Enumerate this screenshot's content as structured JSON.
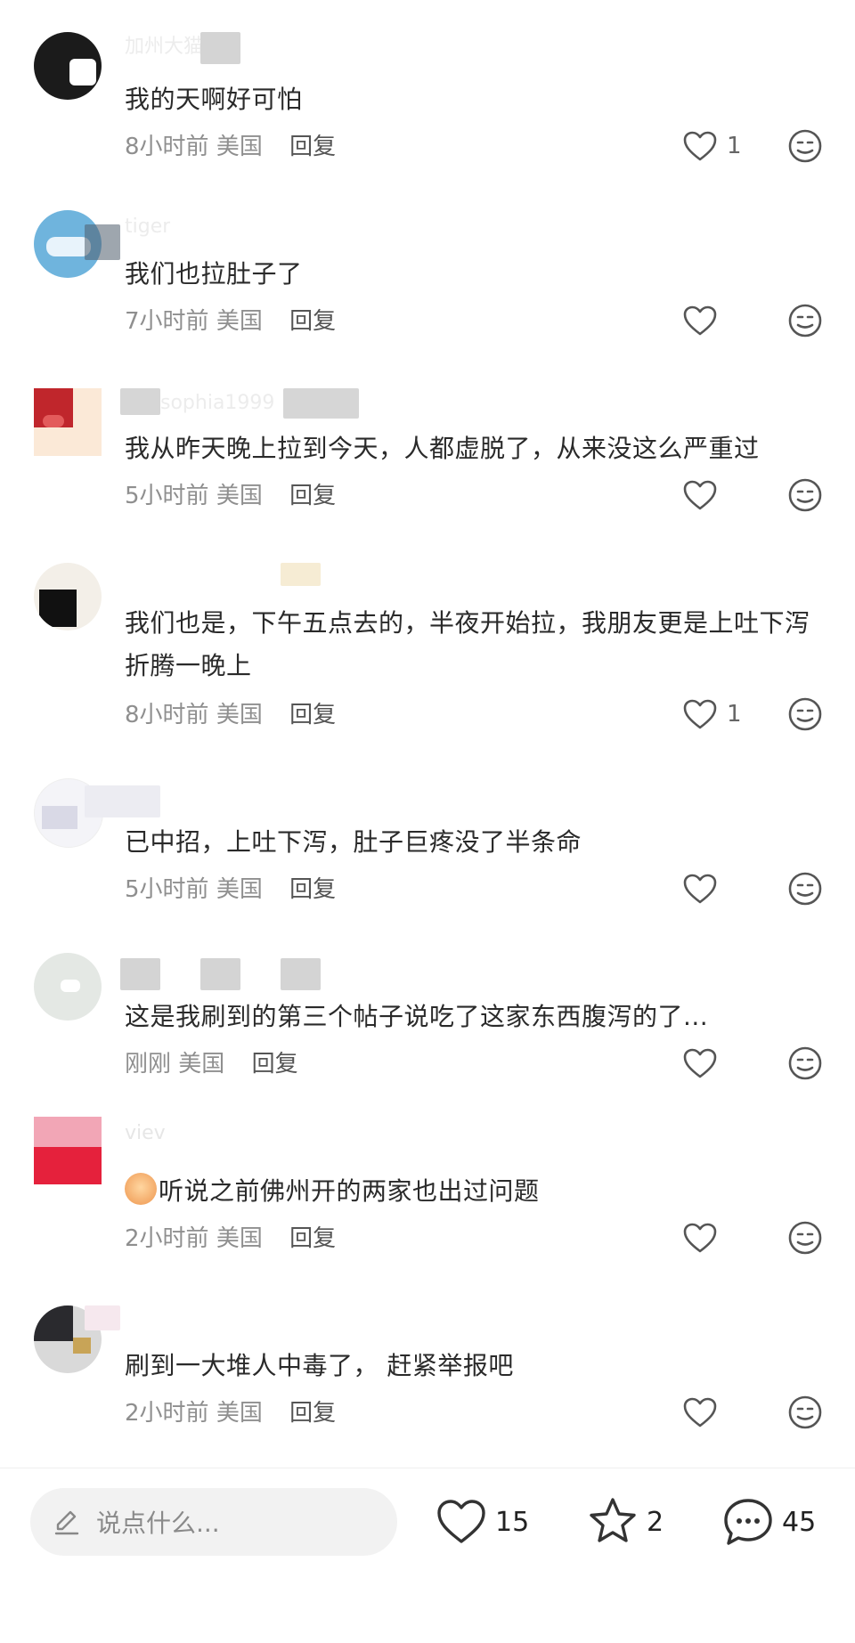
{
  "comments": [
    {
      "username": "加州大猫猫",
      "text": "我的天啊好可怕",
      "time": "8小时前",
      "location": "美国",
      "reply_label": "回复",
      "likes": "1"
    },
    {
      "username": "tiger",
      "text": "我们也拉肚子了",
      "time": "7小时前",
      "location": "美国",
      "reply_label": "回复",
      "likes": ""
    },
    {
      "username": "sophia1999",
      "text": "我从昨天晚上拉到今天，人都虚脱了，从来没这么严重过",
      "time": "5小时前",
      "location": "美国",
      "reply_label": "回复",
      "likes": ""
    },
    {
      "username": "",
      "text": "我们也是，下午五点去的，半夜开始拉，我朋友更是上吐下泻折腾一晚上",
      "time": "8小时前",
      "location": "美国",
      "reply_label": "回复",
      "likes": "1"
    },
    {
      "username": "",
      "text": "已中招，上吐下泻，肚子巨疼没了半条命",
      "time": "5小时前",
      "location": "美国",
      "reply_label": "回复",
      "likes": ""
    },
    {
      "username": "",
      "text": "这是我刷到的第三个帖子说吃了这家东西腹泻的了...",
      "time": "刚刚",
      "location": "美国",
      "reply_label": "回复",
      "likes": ""
    },
    {
      "username": "viev",
      "text": "听说之前佛州开的两家也出过问题",
      "time": "2小时前",
      "location": "美国",
      "reply_label": "回复",
      "likes": ""
    },
    {
      "username": "",
      "text": "刷到一大堆人中毒了， 赶紧举报吧",
      "time": "2小时前",
      "location": "美国",
      "reply_label": "回复",
      "likes": ""
    }
  ],
  "bottom_bar": {
    "input_placeholder": "说点什么...",
    "like_count": "15",
    "star_count": "2",
    "comment_count": "45"
  },
  "icons": {
    "like": "heart-outline-icon",
    "emoji": "meh-face-icon",
    "pen": "pen-icon",
    "star": "star-outline-icon",
    "comment": "chat-bubble-icon"
  },
  "colors": {
    "icon_stroke": "#555555",
    "text_primary": "#2a2a2a",
    "text_meta": "#8f8f8f",
    "input_bg": "#f2f2f2"
  }
}
